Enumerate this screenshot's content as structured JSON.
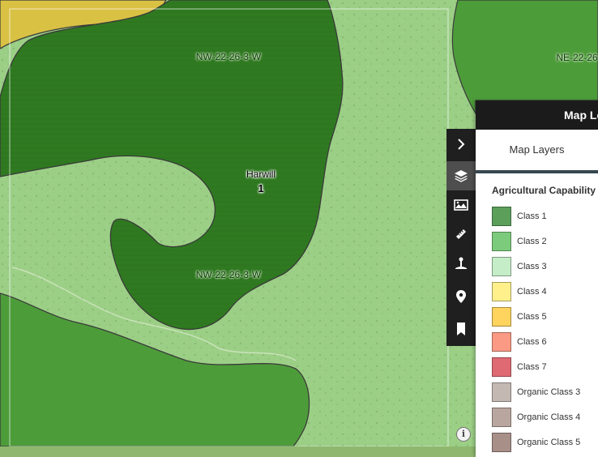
{
  "map": {
    "parcel_labels": [
      "NW-22-26-3-W",
      "NW-22-26-3-W",
      "NE-22-26"
    ],
    "site": {
      "name": "Harwill",
      "number": "1"
    }
  },
  "toolbar": {
    "tools": [
      {
        "name": "collapse",
        "icon": "chevron-right-icon",
        "active": false
      },
      {
        "name": "map-layers",
        "icon": "layers-icon",
        "active": true
      },
      {
        "name": "basemap",
        "icon": "map-image-icon",
        "active": false
      },
      {
        "name": "measure",
        "icon": "ruler-icon",
        "active": false
      },
      {
        "name": "soil-sample",
        "icon": "soil-probe-icon",
        "active": false
      },
      {
        "name": "location",
        "icon": "location-pin-icon",
        "active": false
      },
      {
        "name": "bookmarks",
        "icon": "bookmark-icon",
        "active": false
      }
    ]
  },
  "legend": {
    "header": "Map Legend",
    "tab": "Map Layers",
    "section_title": "Agricultural Capability",
    "items": [
      {
        "label": "Class 1",
        "color": "#5b9f5b"
      },
      {
        "label": "Class 2",
        "color": "#7ccb7c"
      },
      {
        "label": "Class 3",
        "color": "#c4edc8"
      },
      {
        "label": "Class 4",
        "color": "#fff08c"
      },
      {
        "label": "Class 5",
        "color": "#ffd45e"
      },
      {
        "label": "Class 6",
        "color": "#fa9a84"
      },
      {
        "label": "Class 7",
        "color": "#df6a73"
      },
      {
        "label": "Organic Class 3",
        "color": "#c4b8b3"
      },
      {
        "label": "Organic Class 4",
        "color": "#b9a79f"
      },
      {
        "label": "Organic Class 5",
        "color": "#a89088"
      }
    ]
  },
  "colors": {
    "class1_zone": "#2f7a21",
    "class2_zone": "#4d9c3a",
    "class3_zone": "#9ccf86",
    "class4_zone": "#d9c144",
    "toolbar_bg": "#1f1f1f"
  },
  "info_button": {
    "label": "i"
  }
}
